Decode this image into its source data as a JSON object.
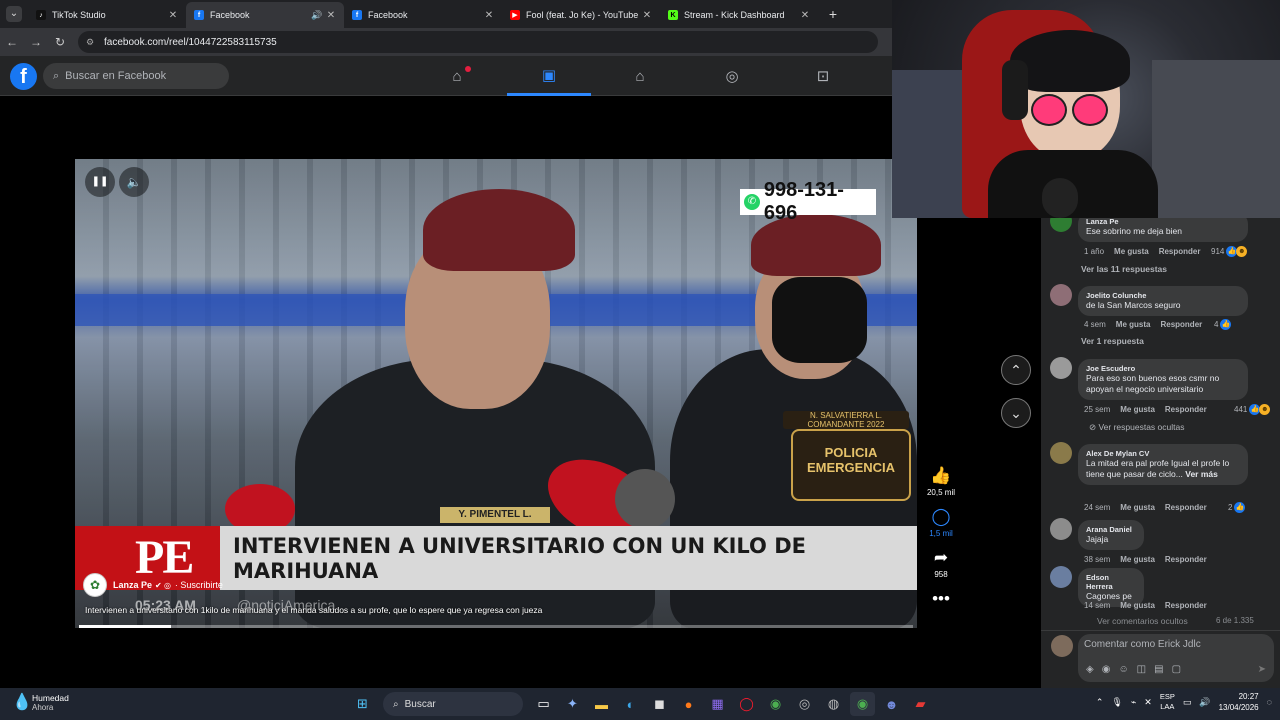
{
  "browser": {
    "tabs": [
      {
        "title": "TikTok Studio",
        "favicon": "tiktok-icon",
        "color": "#111111"
      },
      {
        "title": "Facebook",
        "favicon": "facebook-icon",
        "color": "#1877f2",
        "active": true,
        "audio": true
      },
      {
        "title": "Facebook",
        "favicon": "facebook-icon",
        "color": "#1877f2"
      },
      {
        "title": "Fool (feat. Jo Ke) - YouTube",
        "favicon": "youtube-icon",
        "color": "#ff0000"
      },
      {
        "title": "Stream - Kick Dashboard",
        "favicon": "kick-icon",
        "color": "#53fc18"
      }
    ],
    "url": "facebook.com/reel/1044722583115735"
  },
  "facebook": {
    "search_placeholder": "Buscar en Facebook",
    "nav": [
      "home-icon",
      "reels-icon",
      "marketplace-icon",
      "groups-icon",
      "gaming-icon"
    ],
    "accent": "#2d88ff"
  },
  "video": {
    "phone": "998-131-696",
    "headline": "INTERVIENEN A UNIVERSITARIO CON UN KILO DE MARIHUANA",
    "channel_logo": "PE",
    "time_overlay": "05:23 AM",
    "handle_overlay": "@noticiAmerica",
    "badge_name": "N. SALVATIERRA L.",
    "badge_rank": "COMANDANTE 2022",
    "badge_text": "POLICIA EMERGENCIA",
    "name_tag": "Y. PIMENTEL L.",
    "page_name": "Lanza Pe",
    "subscribe": "· Suscribirte",
    "caption": "Intervienen a universitario con 1kilo de marihuana y el manda saludos a su profe, que lo espere que ya regresa con jueza",
    "progress": 0.11
  },
  "actions": {
    "likes": "20,5 mil",
    "comments": "1,5 mil",
    "shares": "958"
  },
  "comments": [
    {
      "author": "Lanza Pe",
      "text": "Ese sobrino me deja bien",
      "time": "1 año",
      "count": "914",
      "reactions": [
        "like",
        "haha"
      ],
      "replies": "Ver las 11 respuestas"
    },
    {
      "author": "Joelito Colunche",
      "text": "de la San Marcos seguro",
      "time": "4 sem",
      "count": "4",
      "reactions": [
        "like"
      ],
      "replies": "Ver 1 respuesta"
    },
    {
      "author": "Joe Escudero",
      "text": "Para eso son buenos esos csmr no apoyan el negocio universitario",
      "time": "25 sem",
      "count": "441",
      "reactions": [
        "like",
        "haha"
      ],
      "replies": "Ver respuestas ocultas"
    },
    {
      "author": "Alex De Mylan CV",
      "text": "La mitad era pal profe Igual el profe lo tiene que pasar de ciclo...",
      "more": "Ver más",
      "time": "24 sem",
      "count": "2",
      "reactions": [
        "like"
      ]
    },
    {
      "author": "Arana Daniel",
      "text": "Jajaja",
      "time": "38 sem"
    },
    {
      "author": "Edson Herrera",
      "text": "Cagones pe",
      "time": "14 sem"
    }
  ],
  "comment_actions": {
    "like": "Me gusta",
    "reply": "Responder"
  },
  "hidden_comments": "Ver comentarios ocultos",
  "pagination": "6 de 1.335",
  "compose_placeholder": "Comentar como Erick Jdlc",
  "taskbar": {
    "weather_title": "Humedad",
    "weather_sub": "Ahora",
    "search": "Buscar",
    "lang_top": "ESP",
    "lang_bottom": "LAA",
    "time": "20:27",
    "date": "13/04/2026"
  }
}
